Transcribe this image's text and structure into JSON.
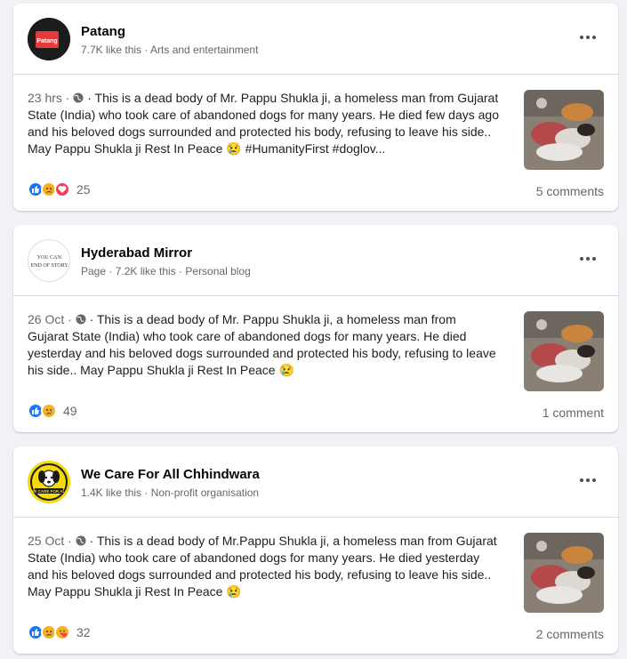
{
  "posts": [
    {
      "page_name": "Patang",
      "page_meta": "7.7K like this · Arts and entertainment",
      "avatar_text": "Patang",
      "time": "23 hrs · ",
      "body": " · This is a dead body of Mr. Pappu Shukla ji, a homeless man from Gujarat State (India) who took care of abandoned dogs for many years. He died few days ago and his beloved dogs surrounded and protected his body, refusing to leave his side.. May Pappu Shukla ji Rest In Peace 😢 #HumanityFirst #doglov...",
      "reactions": [
        "like-icon",
        "sad-icon",
        "love-icon"
      ],
      "reaction_count": "25",
      "comments": "5 comments"
    },
    {
      "page_name": "Hyderabad Mirror",
      "page_meta": "Page · 7.2K like this · Personal blog",
      "avatar_text": "YOU CAN. END OF STORY.",
      "time": "26 Oct · ",
      "body": " · This is a dead body of Mr. Pappu Shukla ji, a homeless man from Gujarat State (India) who took care of abandoned dogs for many years. He died yesterday and his beloved dogs surrounded and protected his body, refusing to leave his side.. May Pappu Shukla ji Rest In Peace 😢",
      "reactions": [
        "like-icon",
        "sad-icon"
      ],
      "reaction_count": "49",
      "comments": "1 comment"
    },
    {
      "page_name": "We Care For All Chhindwara",
      "page_meta": "1.4K like this · Non-profit organisation",
      "avatar_text": "WE CARE FOR ALL",
      "time": "25 Oct · ",
      "body": " · This is a dead body of Mr.Pappu Shukla ji, a homeless man from Gujarat State (India) who took care of abandoned dogs for many years. He died yesterday and his beloved dogs surrounded and protected his body, refusing to leave his side.. May Pappu Shukla ji Rest In Peace 😢",
      "reactions": [
        "like-icon",
        "sad-icon",
        "care-icon"
      ],
      "reaction_count": "32",
      "comments": "2 comments"
    }
  ],
  "colors": {
    "like": "#1877f2",
    "sad": "#f7b125",
    "love": "#f33e58",
    "patang_bg": "#1c1c1c",
    "patang_red": "#e63a3a",
    "chhindwara_yellow": "#f5d90a"
  }
}
